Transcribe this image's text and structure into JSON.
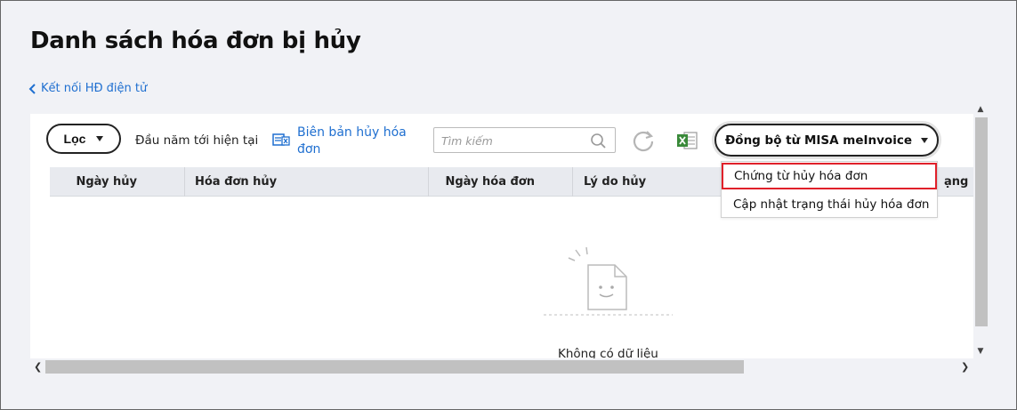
{
  "page": {
    "title": "Danh sách hóa đơn bị hủy",
    "back_link": "Kết nối HĐ điện tử"
  },
  "toolbar": {
    "filter_label": "Lọc",
    "period_label": "Đầu năm tới hiện tại",
    "report_link": "Biên bản hủy hóa đơn",
    "search_placeholder": "Tìm kiếm",
    "sync_button": "Đồng bộ từ MISA meInvoice"
  },
  "grid": {
    "columns": [
      "Ngày hủy",
      "Hóa đơn hủy",
      "Ngày hóa đơn",
      "Lý do hủy"
    ],
    "trailing_column_fragment": "ạng",
    "empty_text": "Không có dữ liệu"
  },
  "dropdown": {
    "items": [
      "Chứng từ hủy hóa đơn",
      "Cập nhật trạng thái hủy hóa đơn"
    ],
    "highlighted_index": 0,
    "highlight_color": "#e0202a"
  },
  "colors": {
    "link": "#1f6fd0",
    "header_bg": "#e8eaef",
    "page_bg": "#f1f2f6"
  },
  "icons": {
    "back": "chevron-left-icon",
    "report": "document-cancel-icon",
    "search": "search-icon",
    "refresh": "refresh-icon",
    "export": "excel-icon"
  }
}
